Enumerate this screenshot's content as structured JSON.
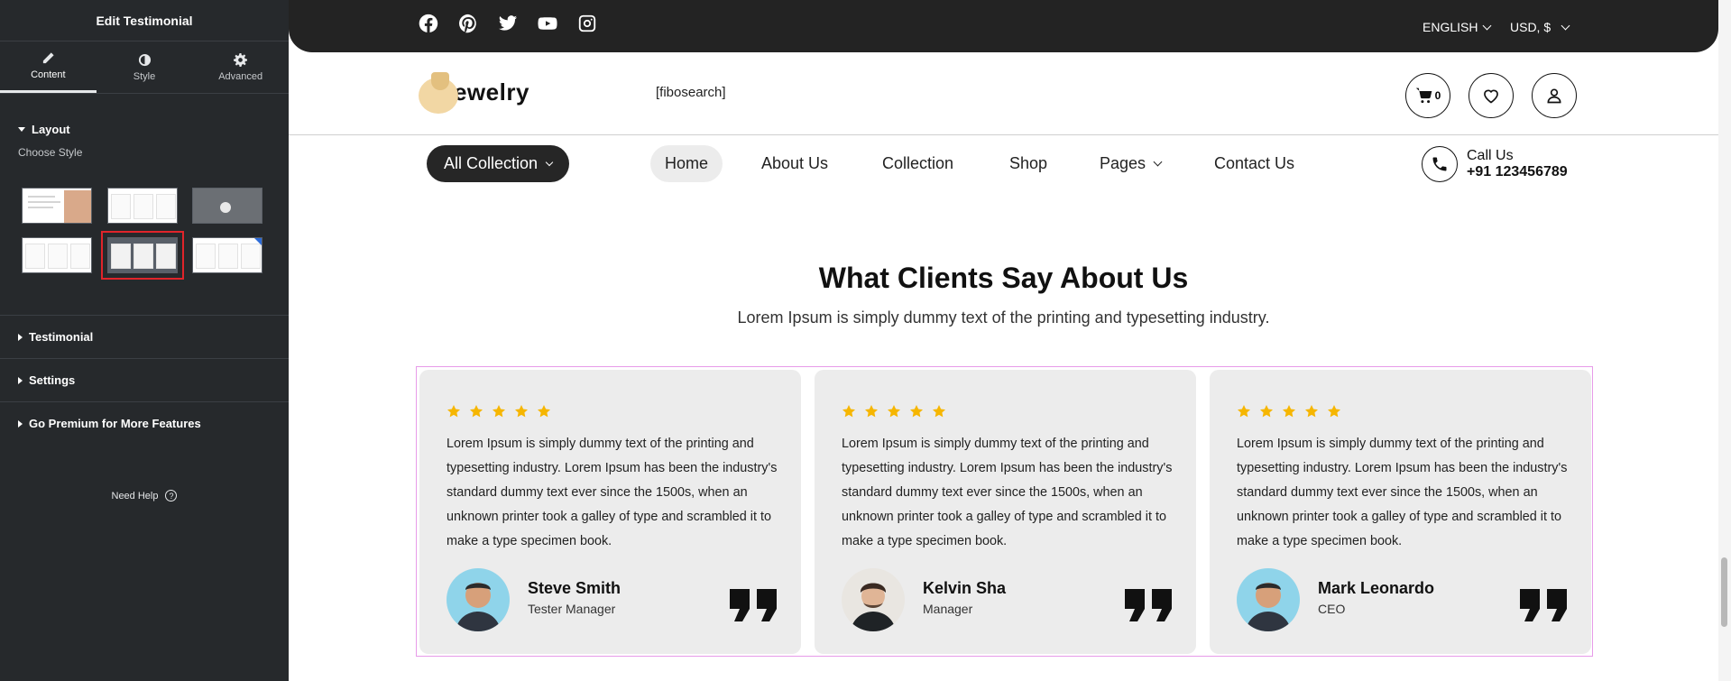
{
  "panel": {
    "title": "Edit Testimonial",
    "tabs": [
      {
        "label": "Content",
        "icon": "pencil-icon",
        "active": true
      },
      {
        "label": "Style",
        "icon": "contrast-icon",
        "active": false
      },
      {
        "label": "Advanced",
        "icon": "gear-icon",
        "active": false
      }
    ],
    "layout_label": "Layout",
    "choose_style_label": "Choose Style",
    "selected_style": 5,
    "sections": [
      "Testimonial",
      "Settings",
      "Go Premium for More Features"
    ],
    "help_label": "Need Help",
    "help_glyph": "?"
  },
  "site": {
    "social_icons": [
      "facebook-icon",
      "pinterest-icon",
      "twitter-icon",
      "youtube-icon",
      "instagram-icon"
    ],
    "language": "ENGLISH",
    "currency": "USD, $",
    "logo_text": "Jewelry",
    "search_placeholder": "[fibosearch]",
    "cart_count": "0",
    "all_collection": "All Collection",
    "nav": [
      "Home",
      "About Us",
      "Collection",
      "Shop",
      "Pages",
      "Contact Us"
    ],
    "call_label": "Call Us",
    "call_number": "+91 123456789",
    "section_title": "What Clients Say About Us",
    "section_subtitle": "Lorem Ipsum is simply dummy text of the printing and typesetting industry.",
    "testimonials": [
      {
        "rating": 5,
        "text": "Lorem Ipsum is simply dummy text of the printing and typesetting industry. Lorem Ipsum has been the industry's standard dummy text ever since the 1500s, when an unknown printer took a galley of type and scrambled it to make a type specimen book.",
        "name": "Steve Smith",
        "role": "Tester Manager"
      },
      {
        "rating": 5,
        "text": "Lorem Ipsum is simply dummy text of the printing and typesetting industry. Lorem Ipsum has been the industry's standard dummy text ever since the 1500s, when an unknown printer took a galley of type and scrambled it to make a type specimen book.",
        "name": "Kelvin Sha",
        "role": "Manager"
      },
      {
        "rating": 5,
        "text": "Lorem Ipsum is simply dummy text of the printing and typesetting industry. Lorem Ipsum has been the industry's standard dummy text ever since the 1500s, when an unknown printer took a galley of type and scrambled it to make a type specimen book.",
        "name": "Mark Leonardo",
        "role": "CEO"
      }
    ]
  },
  "colors": {
    "panel_bg": "#26292c",
    "topbar_bg": "#232323",
    "star": "#f6b600",
    "card_bg": "#ececec",
    "selection_red": "#e0242a",
    "outline_pink": "#e79be9"
  }
}
